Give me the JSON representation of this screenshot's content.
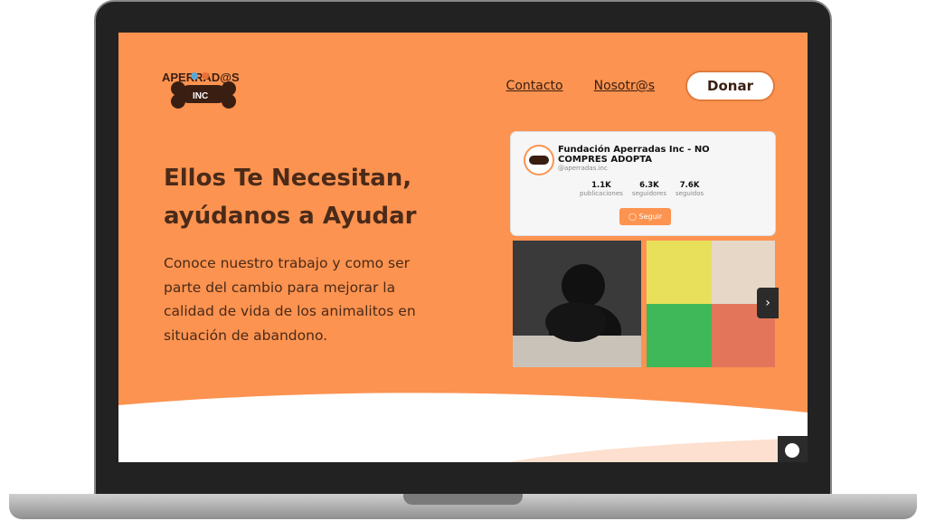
{
  "logo": {
    "brand_text": "APERRAD@S",
    "sub_text": "INC"
  },
  "nav": {
    "items": [
      "Contacto",
      "Nosotr@s"
    ],
    "donate_label": "Donar"
  },
  "hero": {
    "headline_line1": "Ellos Te Necesitan,",
    "headline_line2": "ayúdanos a Ayudar",
    "body": "Conoce nuestro trabajo y como ser parte del cambio para mejorar la calidad de vida de los animalitos en situación de abandono."
  },
  "instagram": {
    "name": "Fundación Aperradas Inc - NO COMPRES ADOPTA",
    "handle": "@aperradas.inc",
    "stats": [
      {
        "value": "1.1K",
        "label": "publicaciones"
      },
      {
        "value": "6.3K",
        "label": "seguidores"
      },
      {
        "value": "7.6K",
        "label": "seguidos"
      }
    ],
    "follow_label": "Seguir"
  },
  "colors": {
    "accent": "#fc9350",
    "text_dark": "#4a2a18"
  },
  "icons": {
    "chat": "chat-icon",
    "next": "chevron-right-icon",
    "instagram": "instagram-icon"
  }
}
